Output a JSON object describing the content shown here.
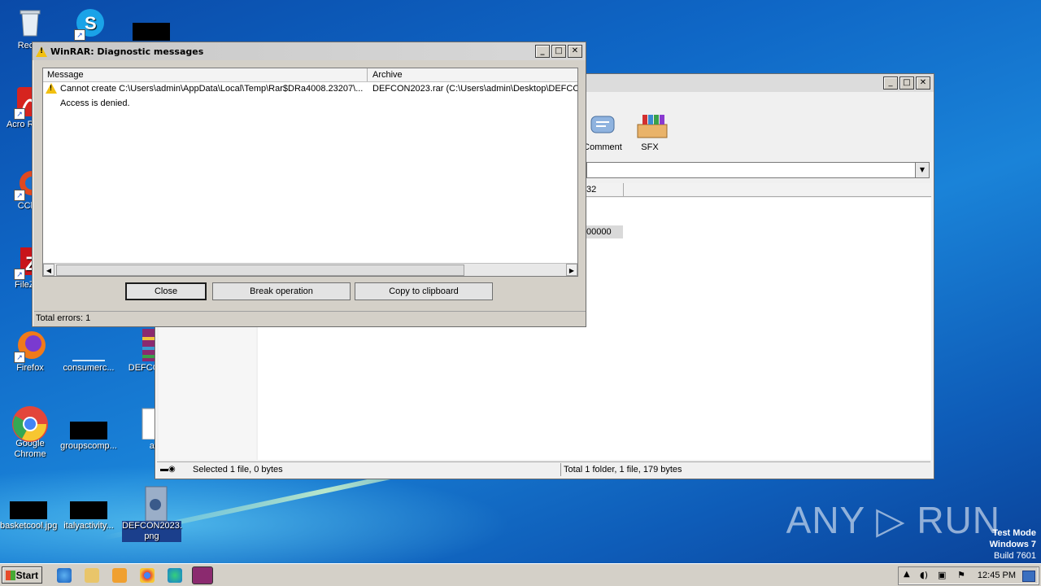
{
  "desktop": {
    "icons": [
      {
        "label": "Recycle Bin",
        "icon": "recycle-bin-icon"
      },
      {
        "label": "Skype",
        "icon": "skype-icon"
      },
      {
        "label": "Acrobat Reader",
        "icon": "acrobat-reader-icon"
      },
      {
        "label": "CCleaner",
        "icon": "ccleaner-icon"
      },
      {
        "label": "FileZilla",
        "icon": "filezilla-icon"
      },
      {
        "label": "Firefox",
        "icon": "firefox-icon"
      },
      {
        "label": "consumerc...",
        "icon": "file-icon"
      },
      {
        "label": "DEFCON...",
        "icon": "winrar-archive-icon"
      },
      {
        "label": "Google Chrome",
        "icon": "chrome-icon"
      },
      {
        "label": "groupscomp...",
        "icon": "file-icon"
      },
      {
        "label": "a.t",
        "icon": "text-file-icon"
      },
      {
        "label": "basketcool.jpg",
        "icon": "image-file-icon"
      },
      {
        "label": "italyactivity...",
        "icon": "file-icon"
      },
      {
        "label": "DEFCON2023.png",
        "icon": "png-file-icon"
      }
    ],
    "labels": {
      "recycle": "Recyc",
      "acro": "Acro Reade",
      "ccleaner": "CClea",
      "filezilla": "FileZilla",
      "firefox": "Firefox",
      "consumer": "consumerc...",
      "defcon_rar": "DEFCON",
      "chrome_line1": "Google",
      "chrome_line2": "Chrome",
      "groups": "groupscomp...",
      "at": "a.t",
      "basket": "basketcool.jpg",
      "italy": "italyactivity...",
      "defcon_png_line1": "DEFCON2023.",
      "defcon_png_line2": "png"
    }
  },
  "winrar_main": {
    "toolbar": {
      "comment_label": "Comment",
      "sfx_label": "SFX"
    },
    "list_header_col": "32",
    "list_row_value": "00000",
    "status_left": "Selected 1 file, 0 bytes",
    "status_right": "Total 1 folder, 1 file, 179 bytes"
  },
  "diagnostic": {
    "title": "WinRAR: Diagnostic messages",
    "columns": {
      "message": "Message",
      "archive": "Archive"
    },
    "rows": [
      {
        "message": "Cannot create C:\\Users\\admin\\AppData\\Local\\Temp\\Rar$DRa4008.23207\\...",
        "archive": "DEFCON2023.rar (C:\\Users\\admin\\Desktop\\DEFCON"
      },
      {
        "message": "Access is denied.",
        "archive": ""
      }
    ],
    "buttons": {
      "close": "Close",
      "break": "Break operation",
      "copy": "Copy to clipboard"
    },
    "status": "Total errors: 1"
  },
  "watermark": {
    "brand": "ANY ▷ RUN",
    "test_mode": "Test Mode",
    "os": "Windows 7",
    "build": "Build 7601"
  },
  "taskbar": {
    "start_label": "Start",
    "clock": "12:45 PM"
  },
  "colors": {
    "desktop_blue": "#0f67c6",
    "warning_yellow": "#f2c010"
  }
}
